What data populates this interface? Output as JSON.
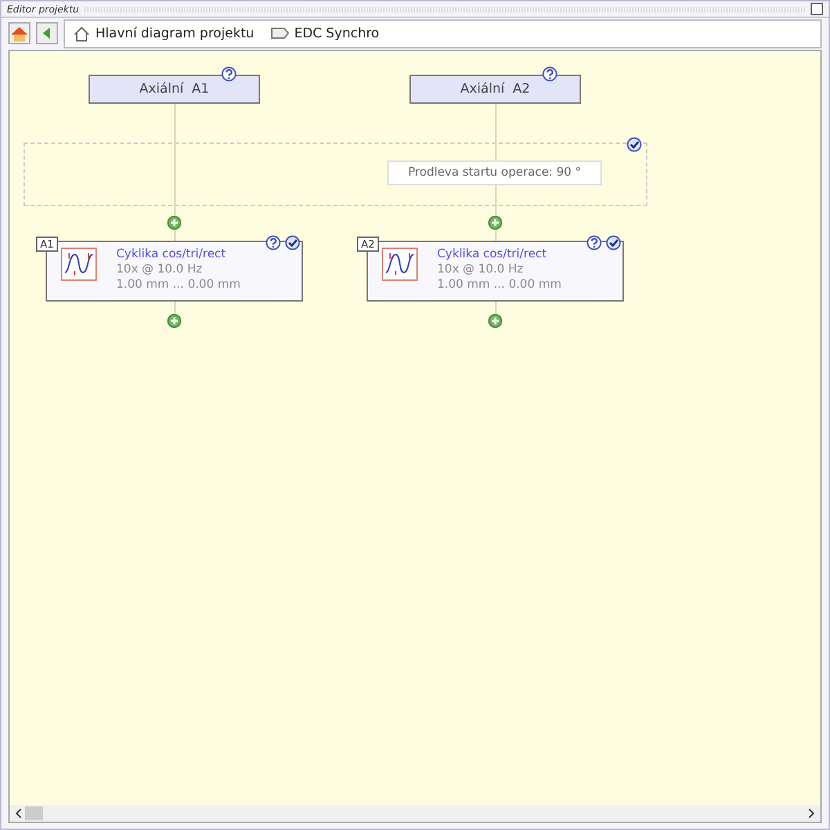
{
  "window": {
    "title": "Editor projektu"
  },
  "breadcrumbs": [
    {
      "kind": "home",
      "label": "Hlavní diagram projektu"
    },
    {
      "kind": "tag",
      "label": "EDC Synchro"
    }
  ],
  "delay": {
    "label": "Prodleva startu operace: 90 °"
  },
  "axes": [
    {
      "name": "Axiální  A1",
      "operation": {
        "tag": "A1",
        "title": "Cyklika cos/tri/rect",
        "line1": "10x @ 10.0 Hz",
        "line2": "1.00 mm ... 0.00 mm"
      }
    },
    {
      "name": "Axiální  A2",
      "operation": {
        "tag": "A2",
        "title": "Cyklika cos/tri/rect",
        "line1": "10x @ 10.0 Hz",
        "line2": "1.00 mm ... 0.00 mm"
      }
    }
  ]
}
